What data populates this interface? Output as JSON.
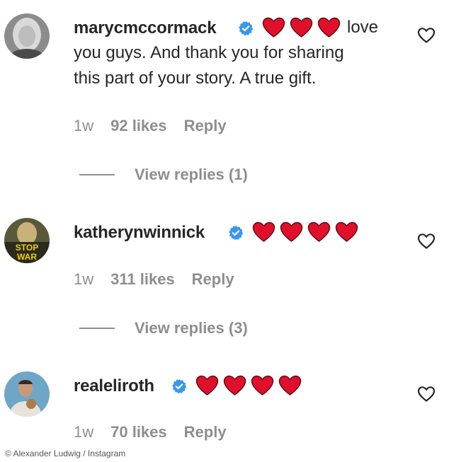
{
  "comments": [
    {
      "username": "marycmccormack",
      "text_inline": "love",
      "text_lines": [
        "you guys. And thank you for sharing",
        "this part of your story. A true gift."
      ],
      "time": "1w",
      "likes": "92 likes",
      "reply": "Reply",
      "view_replies": "View replies (1)",
      "avatar_icon": "woman-avatar",
      "heart_count": 3
    },
    {
      "username": "katherynwinnick",
      "time": "1w",
      "likes": "311 likes",
      "reply": "Reply",
      "view_replies": "View replies (3)",
      "avatar_icon": "stop-war-avatar",
      "avatar_text": "STOP WAR",
      "heart_count": 4
    },
    {
      "username": "realeliroth",
      "time": "1w",
      "likes": "70 likes",
      "reply": "Reply",
      "avatar_icon": "man-avatar",
      "heart_count": 4
    }
  ],
  "icons": {
    "verified": "verified-badge-icon",
    "heart_emoji": "red-heart-icon",
    "like": "heart-outline-icon"
  },
  "colors": {
    "verified": "#3897f0",
    "heart": "#e0102b",
    "muted": "#8e8e8e",
    "text": "#262626"
  },
  "credit": "© Alexander Ludwig / Instagram"
}
